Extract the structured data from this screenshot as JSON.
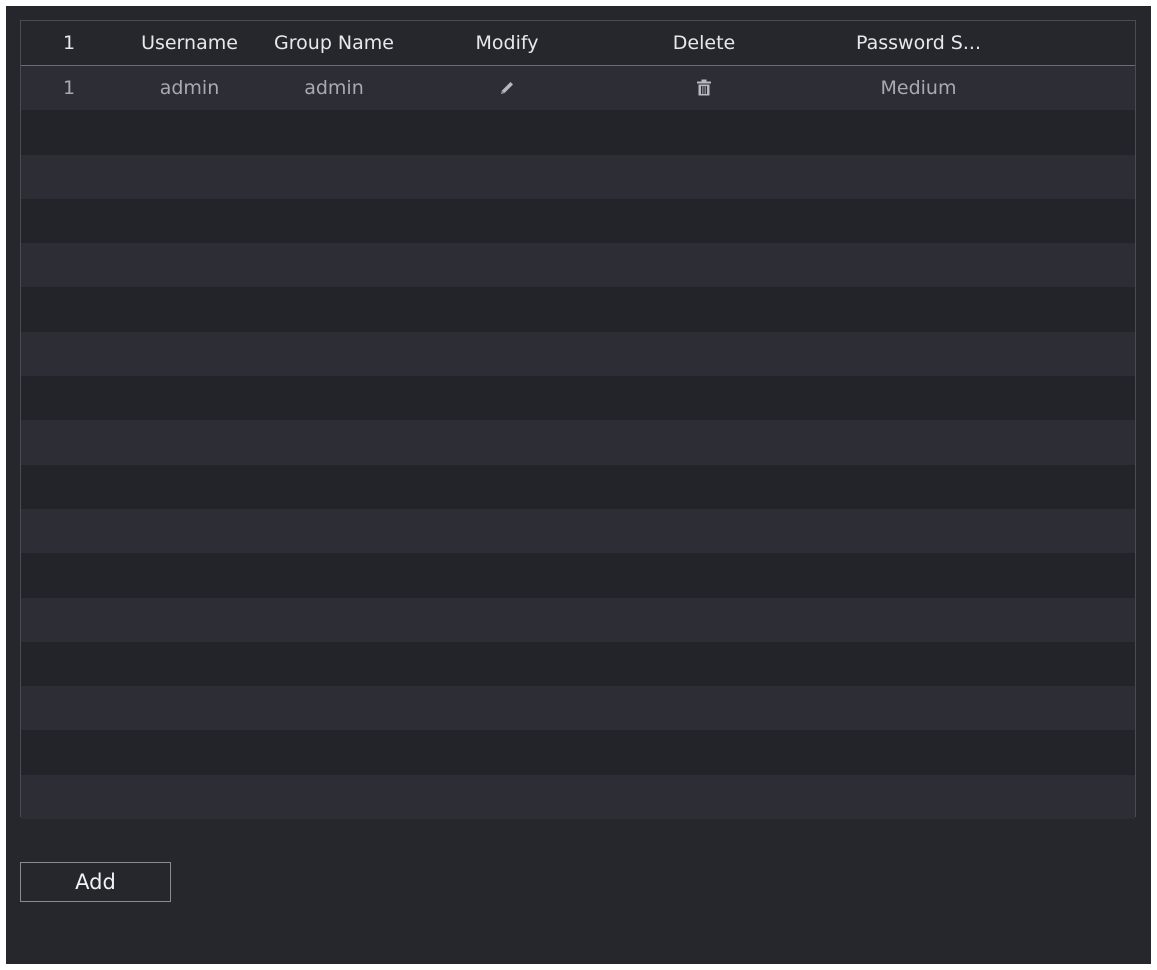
{
  "table": {
    "headers": [
      "1",
      "Username",
      "Group Name",
      "Modify",
      "Delete",
      "Password S..."
    ],
    "rows": [
      {
        "no": "1",
        "username": "admin",
        "group": "admin",
        "modify_icon": "pencil-icon",
        "delete_icon": "trash-icon",
        "password_strength": "Medium"
      }
    ]
  },
  "actions": {
    "add_label": "Add"
  },
  "colors": {
    "panel_bg": "#26272d",
    "row_stripe": "#2d2e35",
    "header_text": "#e8e8ea",
    "cell_text": "#a9aab0"
  }
}
